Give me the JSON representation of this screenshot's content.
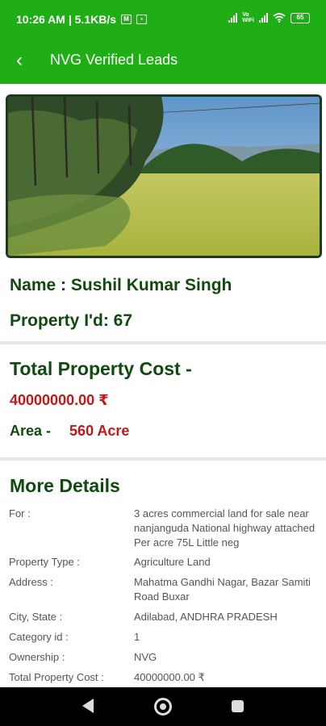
{
  "status": {
    "time_text": "10:26 AM | 5.1KB/s",
    "battery": "65"
  },
  "appbar": {
    "title": "NVG Verified Leads"
  },
  "property": {
    "name_line": "Name : Sushil Kumar Singh",
    "id_line": "Property I'd: 67"
  },
  "cost": {
    "title": "Total Property Cost -",
    "value": "40000000.00 ₹",
    "area_label": "Area -",
    "area_value": "560 Acre"
  },
  "more": {
    "title": "More Details",
    "rows": [
      {
        "label": "For :",
        "value": "3 acres commercial land for sale near nanjanguda National highway attached Per acre 75L Little neg"
      },
      {
        "label": "Property Type :",
        "value": "Agriculture Land"
      },
      {
        "label": "Address :",
        "value": "Mahatma Gandhi Nagar, Bazar Samiti Road Buxar"
      },
      {
        "label": "City, State :",
        "value": "Adilabad,  ANDHRA PRADESH"
      },
      {
        "label": "Category id :",
        "value": "1"
      },
      {
        "label": "Ownership :",
        "value": "NVG"
      },
      {
        "label": "Total Property Cost :",
        "value": "40000000.00 ₹"
      }
    ]
  },
  "colors": {
    "primary": "#1fae16",
    "heading": "#0f4a0f",
    "price": "#c0181a"
  },
  "icons": [
    "back-arrow-icon",
    "signal-icon",
    "wifi-icon",
    "battery-icon",
    "nav-back-icon",
    "nav-home-icon",
    "nav-recents-icon"
  ]
}
